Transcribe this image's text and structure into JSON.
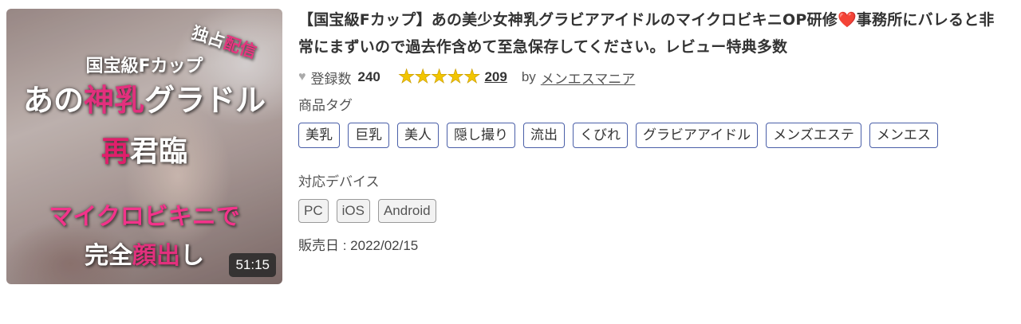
{
  "thumbnail": {
    "exclusive_pre": "独占",
    "exclusive_pink": "配信",
    "rank_text": "国宝級Fカップ",
    "main_pre": "あの",
    "main_pink": "神乳",
    "main_post": "グラドル",
    "again_pink": "再",
    "again_white": "君臨",
    "bikini_text": "マイクロビキニで",
    "face_pre": "完全",
    "face_pink": "顔出",
    "face_post": "し",
    "duration": "51:15"
  },
  "product": {
    "title_part1": "【国宝級Fカップ】あの美少女神乳グラビアアイドルのマイクロビキニOP研修",
    "title_heart": "❤️",
    "title_part2": "事務所にバレると非常にまずいので過去作含めて至急保存してください。レビュー特典多数",
    "favorite_icon": "heart-icon",
    "registered_label": "登録数",
    "registered_count": "240",
    "rating_stars": 5,
    "review_count": "209",
    "by_label": "by",
    "maker": "メンエスマニア",
    "tags_label": "商品タグ",
    "tags": [
      "美乳",
      "巨乳",
      "美人",
      "隠し撮り",
      "流出",
      "くびれ",
      "グラビアアイドル",
      "メンズエステ",
      "メンエス"
    ],
    "devices_label": "対応デバイス",
    "devices": [
      "PC",
      "iOS",
      "Android"
    ],
    "release_date": "販売日 : 2022/02/15"
  },
  "colors": {
    "tag_border": "#4a5fa8",
    "star": "#f2c500",
    "pink_accent": "#e2307d"
  }
}
